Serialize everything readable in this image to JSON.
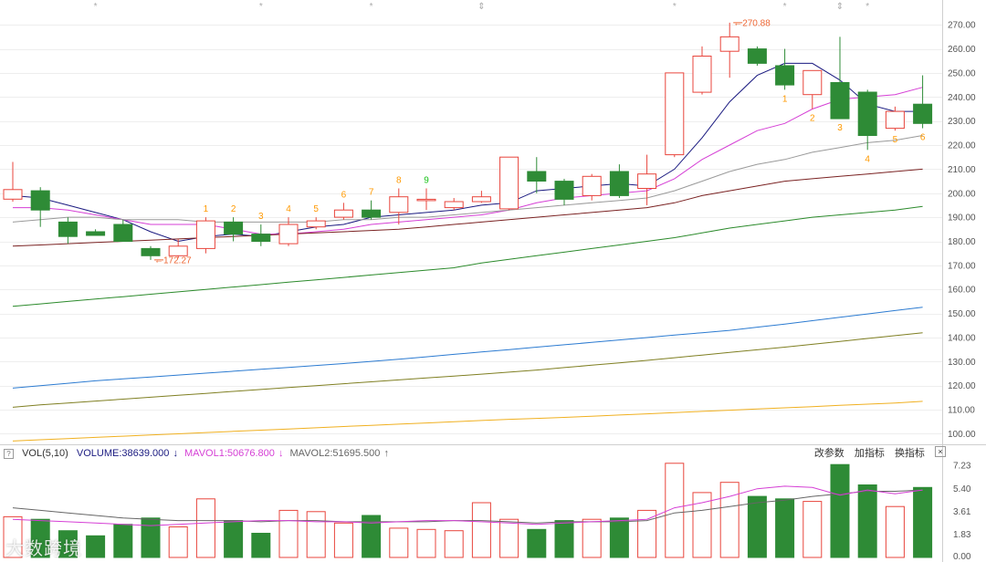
{
  "chart_data": {
    "type": "candlestick",
    "colors": {
      "up": "#e8453c",
      "down": "#2e8b36",
      "tdUp": "#ff9900",
      "tdNine": "#19c319",
      "extreme": "#ee6633"
    },
    "price_axis": {
      "ticks": [
        "100.00",
        "110.00",
        "120.00",
        "130.00",
        "140.00",
        "150.00",
        "160.00",
        "170.00",
        "180.00",
        "190.00",
        "200.00",
        "210.00",
        "220.00",
        "230.00",
        "240.00",
        "250.00",
        "260.00",
        "270.00"
      ],
      "min": 96,
      "max": 275
    },
    "volume_axis": {
      "ticks": [
        "7.23",
        "5.40",
        "3.61",
        "1.83",
        "0.00"
      ],
      "max": 7.6
    },
    "top_markers": [
      "*",
      "*",
      "*",
      "⇕",
      "*",
      "*",
      "⇕",
      "*"
    ],
    "top_marker_idx": [
      3,
      9,
      13,
      17,
      24,
      28,
      30,
      31
    ],
    "candles": [
      {
        "o": 197.5,
        "h": 213,
        "l": 196.5,
        "c": 201.5
      },
      {
        "o": 201,
        "h": 202.5,
        "l": 186,
        "c": 193
      },
      {
        "o": 188,
        "h": 190,
        "l": 179,
        "c": 182
      },
      {
        "o": 184,
        "h": 185,
        "l": 183,
        "c": 182.5
      },
      {
        "o": 187,
        "h": 189,
        "l": 181,
        "c": 180
      },
      {
        "o": 177,
        "h": 178,
        "l": 172.27,
        "c": 174
      },
      {
        "o": 174,
        "h": 181,
        "l": 173,
        "c": 178
      },
      {
        "o": 177,
        "h": 190,
        "l": 175,
        "c": 188.5
      },
      {
        "o": 188,
        "h": 190,
        "l": 180,
        "c": 183
      },
      {
        "o": 183,
        "h": 187,
        "l": 178,
        "c": 180
      },
      {
        "o": 179,
        "h": 190,
        "l": 178,
        "c": 187
      },
      {
        "o": 186,
        "h": 190,
        "l": 185,
        "c": 188.5
      },
      {
        "o": 190,
        "h": 196,
        "l": 189,
        "c": 193
      },
      {
        "o": 193,
        "h": 197,
        "l": 189,
        "c": 190
      },
      {
        "o": 192,
        "h": 202,
        "l": 187,
        "c": 198.5
      },
      {
        "o": 197.5,
        "h": 202,
        "l": 193,
        "c": 197.5
      },
      {
        "o": 194,
        "h": 198,
        "l": 193,
        "c": 196.5
      },
      {
        "o": 196.5,
        "h": 201,
        "l": 196,
        "c": 198.5
      },
      {
        "o": 193.5,
        "h": 215,
        "l": 193,
        "c": 215
      },
      {
        "o": 209,
        "h": 215,
        "l": 200,
        "c": 205
      },
      {
        "o": 205,
        "h": 206,
        "l": 195,
        "c": 197.5
      },
      {
        "o": 199,
        "h": 208,
        "l": 197,
        "c": 207
      },
      {
        "o": 209,
        "h": 212,
        "l": 198,
        "c": 199
      },
      {
        "o": 202,
        "h": 216,
        "l": 195,
        "c": 208
      },
      {
        "o": 216,
        "h": 250,
        "l": 215,
        "c": 250
      },
      {
        "o": 242,
        "h": 261,
        "l": 241,
        "c": 257
      },
      {
        "o": 259,
        "h": 270.88,
        "l": 248,
        "c": 265
      },
      {
        "o": 260,
        "h": 261,
        "l": 253,
        "c": 254
      },
      {
        "o": 253,
        "h": 260,
        "l": 243,
        "c": 245
      },
      {
        "o": 241,
        "h": 251,
        "l": 235,
        "c": 251
      },
      {
        "o": 246,
        "h": 265,
        "l": 231,
        "c": 231
      },
      {
        "o": 242,
        "h": 243,
        "l": 218,
        "c": 224
      },
      {
        "o": 227,
        "h": 236,
        "l": 226,
        "c": 234
      },
      {
        "o": 237,
        "h": 249,
        "l": 227,
        "c": 229
      }
    ],
    "td_labels": [
      {
        "i": 7,
        "t": "1",
        "pos": "above",
        "c": "tdUp"
      },
      {
        "i": 8,
        "t": "2",
        "pos": "above",
        "c": "tdUp"
      },
      {
        "i": 9,
        "t": "3",
        "pos": "above",
        "c": "tdUp"
      },
      {
        "i": 10,
        "t": "4",
        "pos": "above",
        "c": "tdUp"
      },
      {
        "i": 11,
        "t": "5",
        "pos": "above",
        "c": "tdUp"
      },
      {
        "i": 12,
        "t": "6",
        "pos": "above",
        "c": "tdUp"
      },
      {
        "i": 13,
        "t": "7",
        "pos": "above",
        "c": "tdUp"
      },
      {
        "i": 14,
        "t": "8",
        "pos": "above",
        "c": "tdUp"
      },
      {
        "i": 15,
        "t": "9",
        "pos": "above",
        "c": "tdNine"
      },
      {
        "i": 28,
        "t": "1",
        "pos": "below",
        "c": "tdUp"
      },
      {
        "i": 29,
        "t": "2",
        "pos": "below",
        "c": "tdUp"
      },
      {
        "i": 30,
        "t": "3",
        "pos": "below",
        "c": "tdUp"
      },
      {
        "i": 31,
        "t": "4",
        "pos": "below",
        "c": "tdUp"
      },
      {
        "i": 32,
        "t": "5",
        "pos": "below",
        "c": "tdUp"
      },
      {
        "i": 33,
        "t": "6",
        "pos": "below",
        "c": "tdUp"
      }
    ],
    "extremes": [
      {
        "i": 5,
        "v": 172.27,
        "text": "172.27",
        "side": "low"
      },
      {
        "i": 26,
        "v": 270.88,
        "text": "270.88",
        "side": "high"
      }
    ],
    "ma_lines": [
      {
        "color": "#1a1a80",
        "values": [
          199,
          198,
          195,
          192,
          189,
          184,
          180,
          182,
          183,
          182,
          184,
          186,
          187,
          190,
          191,
          192,
          193,
          195,
          196,
          201,
          202,
          203,
          204,
          203,
          210,
          223,
          238,
          249,
          254,
          254,
          247,
          237,
          234,
          234
        ]
      },
      {
        "color": "#d53fd5",
        "values": [
          194,
          194,
          193,
          191,
          189,
          187,
          187,
          187,
          185,
          183,
          183,
          184,
          185,
          187,
          188,
          189,
          190,
          191,
          193,
          196,
          198,
          199,
          200,
          201,
          206,
          214,
          220,
          226,
          229,
          235,
          239,
          240,
          241,
          244
        ]
      },
      {
        "color": "#9a9a9a",
        "values": [
          188,
          189,
          190,
          190,
          189,
          189,
          189,
          188,
          188,
          188,
          188,
          188,
          189,
          189,
          190,
          190,
          191,
          192,
          193,
          194,
          195,
          196,
          197,
          198,
          201,
          205,
          209,
          212,
          214,
          217,
          219,
          221,
          222,
          224
        ]
      },
      {
        "color": "#7a2222",
        "values": [
          178,
          178.5,
          179,
          179.5,
          180,
          180.5,
          181,
          181.5,
          182,
          182.5,
          183,
          183.5,
          184,
          184.5,
          185,
          186,
          187,
          188,
          189,
          190,
          191,
          192,
          193,
          194,
          196,
          199,
          201,
          203,
          205,
          206,
          207,
          208,
          209,
          210
        ]
      },
      {
        "color": "#2b8a2b",
        "values": [
          153,
          154,
          155,
          156,
          157,
          158,
          159,
          160,
          161,
          162,
          163,
          164,
          165,
          166,
          167,
          168,
          169,
          171,
          172.5,
          174,
          175.5,
          177,
          178.5,
          180,
          181.5,
          183.5,
          185.5,
          187,
          188.5,
          190,
          191,
          192,
          193,
          194.5
        ]
      },
      {
        "color": "#2c7bd1",
        "values": [
          119,
          120,
          121,
          122,
          122.8,
          123.6,
          124.4,
          125.2,
          126,
          126.8,
          127.6,
          128.4,
          129.2,
          130.1,
          131,
          132,
          133,
          134,
          135,
          136,
          137,
          138,
          139,
          140,
          141,
          142,
          143,
          144.3,
          145.6,
          147,
          148.4,
          149.8,
          151.2,
          152.6
        ]
      },
      {
        "color": "#7f7f22",
        "values": [
          111,
          112,
          112.8,
          113.6,
          114.4,
          115.2,
          116,
          116.8,
          117.6,
          118.4,
          119.2,
          120,
          120.8,
          121.6,
          122.4,
          123.2,
          124,
          124.8,
          125.6,
          126.5,
          127.5,
          128.5,
          129.5,
          130.5,
          131.6,
          132.7,
          133.8,
          134.9,
          136,
          137.2,
          138.4,
          139.6,
          140.8,
          142
        ]
      },
      {
        "color": "#f0b020",
        "values": [
          97,
          97.5,
          98,
          98.5,
          99,
          99.5,
          100,
          100.5,
          101,
          101.5,
          102,
          102.5,
          103,
          103.5,
          104,
          104.5,
          105,
          105.5,
          106,
          106.4,
          106.8,
          107.3,
          107.8,
          108.3,
          108.8,
          109.3,
          109.8,
          110.3,
          110.8,
          111.3,
          111.8,
          112.3,
          112.8,
          113.5
        ]
      }
    ],
    "volumes": [
      3.2,
      3.0,
      2.1,
      1.7,
      2.6,
      3.1,
      2.4,
      4.6,
      2.9,
      1.9,
      3.7,
      3.6,
      2.7,
      3.3,
      2.3,
      2.2,
      2.1,
      4.3,
      3.0,
      2.2,
      2.9,
      3.0,
      3.1,
      3.7,
      7.4,
      5.1,
      5.9,
      4.8,
      4.6,
      4.4,
      7.3,
      5.7,
      4.0,
      5.5
    ],
    "mavol1": [
      3.0,
      2.9,
      2.8,
      2.7,
      2.6,
      2.5,
      2.6,
      2.7,
      2.8,
      2.9,
      2.9,
      2.8,
      2.8,
      2.7,
      2.8,
      2.9,
      2.9,
      2.8,
      2.7,
      2.6,
      2.7,
      2.8,
      2.9,
      3.0,
      3.9,
      4.3,
      4.8,
      5.4,
      5.6,
      5.5,
      4.9,
      5.3,
      5.0,
      5.3
    ],
    "mavol2": [
      3.9,
      3.7,
      3.5,
      3.3,
      3.1,
      3.0,
      2.9,
      2.9,
      2.9,
      2.8,
      2.9,
      2.9,
      2.8,
      2.8,
      2.8,
      2.8,
      2.9,
      2.9,
      2.8,
      2.7,
      2.8,
      2.8,
      2.8,
      2.9,
      3.5,
      3.7,
      4.0,
      4.3,
      4.5,
      4.8,
      5.0,
      5.2,
      5.2,
      5.3
    ]
  },
  "indicator": {
    "name": "VOL(5,10)",
    "volume": "VOLUME:38639.000",
    "volume_arrow": "↓",
    "mavol1": "MAVOL1:50676.800",
    "mavol1_arrow": "↓",
    "mavol2": "MAVOL2:51695.500",
    "mavol2_arrow": "↑",
    "help": "?",
    "colors": {
      "volume": "#1a1a80",
      "mavol1": "#d53fd5",
      "mavol2": "#666666"
    }
  },
  "tools": {
    "change_params": "改参数",
    "add_indicator": "加指标",
    "switch_indicator": "换指标",
    "close": "×"
  },
  "watermark": "大数跨境"
}
